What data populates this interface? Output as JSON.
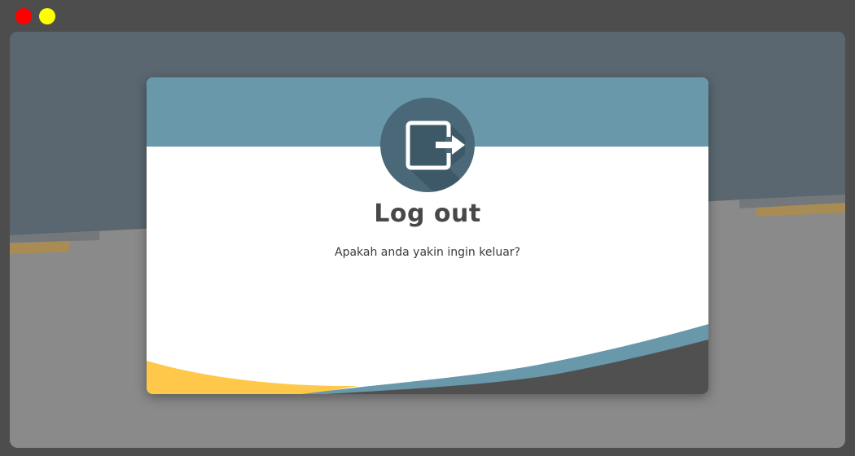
{
  "window": {
    "controls": {
      "close_color": "#ff0000",
      "minimize_color": "#ffff00"
    }
  },
  "colors": {
    "backdrop": "#4d4d4d",
    "app_background_top": "#5a6770",
    "app_background_bottom": "#8a8a8a",
    "accent_blue": "#6898aa",
    "accent_yellow": "#ffc84a",
    "icon_circle": "#4a6878",
    "dark_wave": "#505050"
  },
  "dialog": {
    "icon": "logout-icon",
    "title": "Log out",
    "message": "Apakah anda yakin ingin keluar?"
  }
}
